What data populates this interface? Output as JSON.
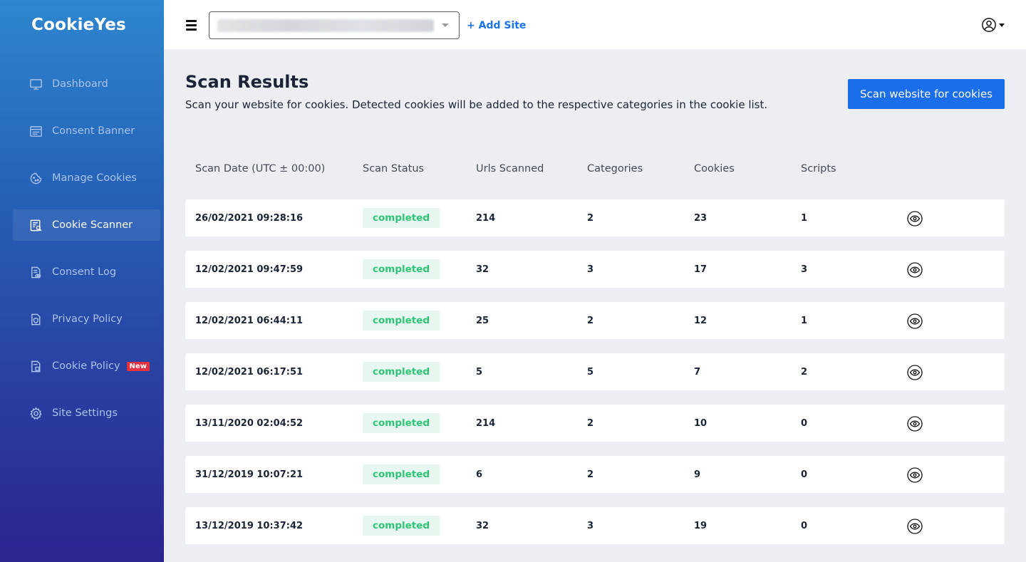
{
  "app": {
    "logo": "CookieYes"
  },
  "sidebar": {
    "items": [
      {
        "label": "Dashboard",
        "icon": "monitor-icon"
      },
      {
        "label": "Consent Banner",
        "icon": "browser-window-icon"
      },
      {
        "label": "Manage Cookies",
        "icon": "cookie-icon"
      },
      {
        "label": "Cookie Scanner",
        "icon": "scanner-list-icon",
        "active": true
      },
      {
        "label": "Consent Log",
        "icon": "document-eye-icon"
      },
      {
        "label": "Privacy Policy",
        "icon": "document-shield-icon"
      },
      {
        "label": "Cookie Policy",
        "icon": "document-cookie-icon",
        "badge": "New"
      },
      {
        "label": "Site Settings",
        "icon": "gear-icon"
      }
    ]
  },
  "topbar": {
    "add_site": "+ Add Site"
  },
  "page": {
    "title": "Scan Results",
    "description": "Scan your website for cookies. Detected cookies will be added to the respective categories in the cookie list.",
    "scan_button": "Scan website for cookies"
  },
  "table": {
    "headers": {
      "date": "Scan Date (UTC ± 00:00)",
      "status": "Scan Status",
      "urls": "Urls Scanned",
      "categories": "Categories",
      "cookies": "Cookies",
      "scripts": "Scripts"
    },
    "rows": [
      {
        "date": "26/02/2021 09:28:16",
        "status": "completed",
        "urls": "214",
        "categories": "2",
        "cookies": "23",
        "scripts": "1"
      },
      {
        "date": "12/02/2021 09:47:59",
        "status": "completed",
        "urls": "32",
        "categories": "3",
        "cookies": "17",
        "scripts": "3"
      },
      {
        "date": "12/02/2021 06:44:11",
        "status": "completed",
        "urls": "25",
        "categories": "2",
        "cookies": "12",
        "scripts": "1"
      },
      {
        "date": "12/02/2021 06:17:51",
        "status": "completed",
        "urls": "5",
        "categories": "5",
        "cookies": "7",
        "scripts": "2"
      },
      {
        "date": "13/11/2020 02:04:52",
        "status": "completed",
        "urls": "214",
        "categories": "2",
        "cookies": "10",
        "scripts": "0"
      },
      {
        "date": "31/12/2019 10:07:21",
        "status": "completed",
        "urls": "6",
        "categories": "2",
        "cookies": "9",
        "scripts": "0"
      },
      {
        "date": "13/12/2019 10:37:42",
        "status": "completed",
        "urls": "32",
        "categories": "3",
        "cookies": "19",
        "scripts": "0"
      }
    ]
  },
  "colors": {
    "accent": "#1a6ee9",
    "status_completed_text": "#2ec47a",
    "status_completed_bg": "#e7f6ee",
    "badge_new": "#e5303f"
  }
}
